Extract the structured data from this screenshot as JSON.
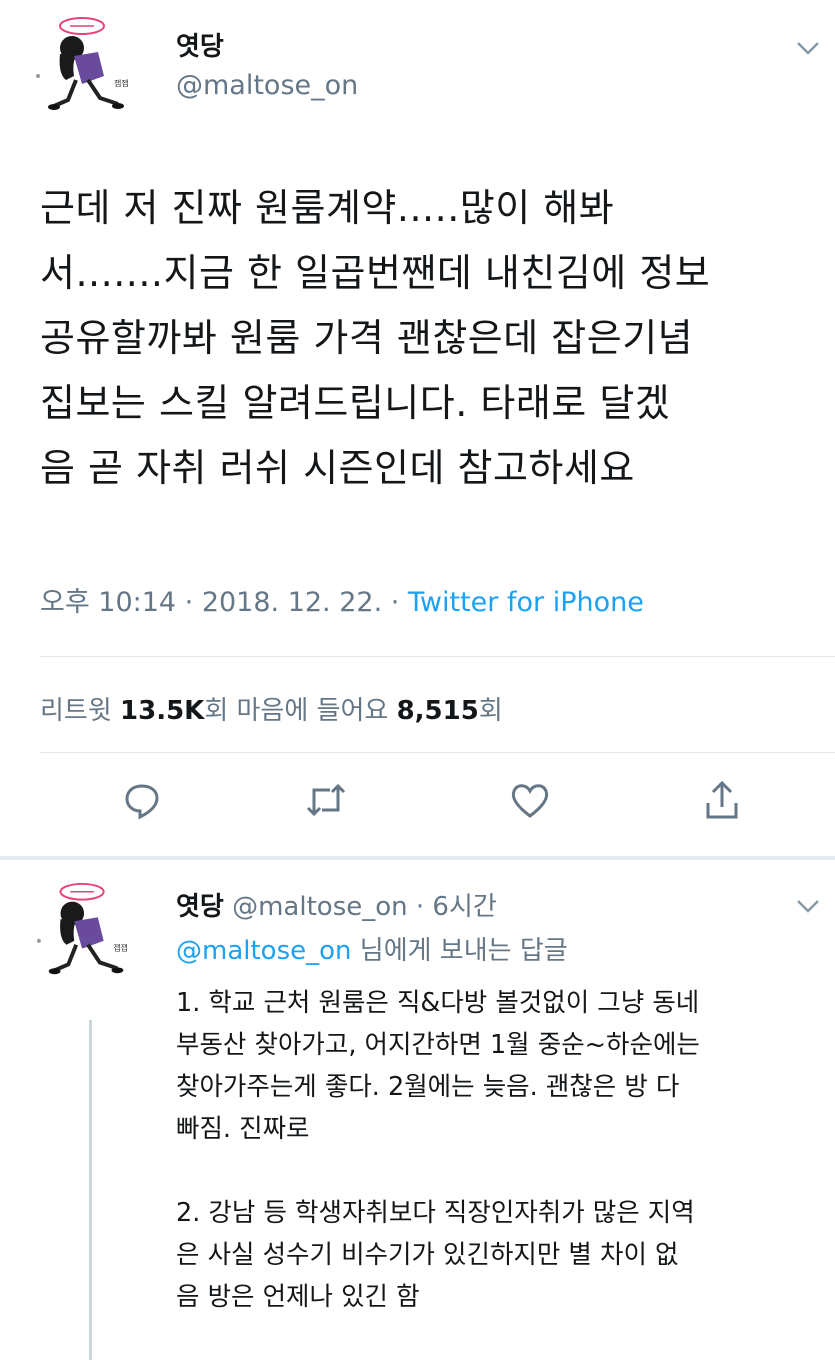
{
  "tweet": {
    "author_name": "엿당",
    "author_handle": "@maltose_on",
    "body_lines": [
      "근데 저 진짜 원룸계약.....많이 해봐",
      "서.......지금 한 일곱번짼데 내친김에 정보",
      "공유할까봐 원룸 가격 괜찮은데 잡은기념",
      "집보는 스킬 알려드립니다. 타래로 달겠",
      "음 곧 자취 러쉬 시즌인데 참고하세요"
    ],
    "timestamp": "오후 10:14 · 2018. 12. 22. · ",
    "source": "Twitter for iPhone",
    "retweet_label": "리트윗 ",
    "retweet_count": "13.5K",
    "retweet_unit": "회",
    "like_label": "  마음에 들어요 ",
    "like_count": "8,515",
    "like_unit": "회",
    "icons": [
      "reply-icon",
      "retweet-icon",
      "like-icon",
      "share-icon",
      "chevron-down-icon"
    ]
  },
  "reply": {
    "author_name": "엿당",
    "author_handle": " @maltose_on",
    "time": " · 6시간",
    "replying_to_handle": "@maltose_on",
    "replying_to_suffix": " 님에게 보내는 답글",
    "body_lines": [
      "1. 학교 근처 원룸은 직&다방 볼것없이 그냥 동네",
      "부동산 찾아가고, 어지간하면 1월 중순~하순에는",
      "찾아가주는게 좋다. 2월에는 늦음. 괜찮은 방 다",
      "빠짐. 진짜로",
      "",
      "2. 강남 등 학생자취보다 직장인자취가 많은 지역",
      "은 사실 성수기 비수기가 있긴하지만 별 차이 없",
      "음 방은 언제나 있긴 함"
    ]
  },
  "colors": {
    "text": "#14171a",
    "secondary": "#657786",
    "link": "#1da1f2",
    "divider": "#e1e8ed",
    "avatar_purple": "#6a4a9c",
    "avatar_bubble": "#e7427a"
  }
}
